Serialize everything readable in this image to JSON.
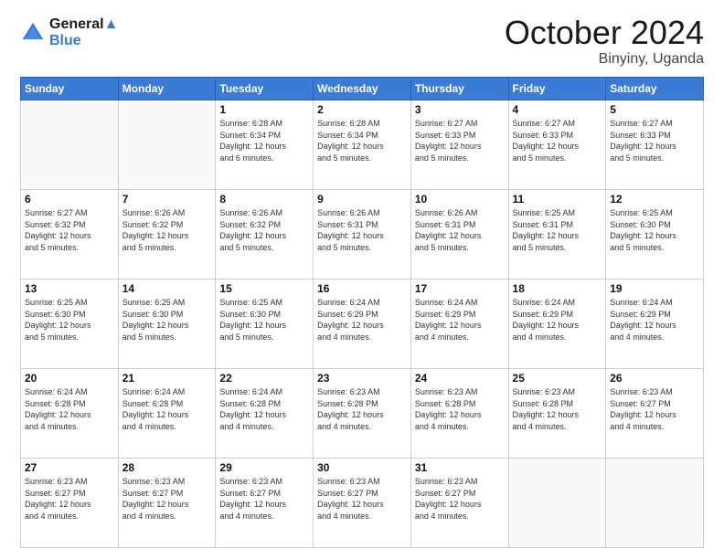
{
  "header": {
    "logo_line1": "General",
    "logo_line2": "Blue",
    "month_title": "October 2024",
    "location": "Binyiny, Uganda"
  },
  "days_of_week": [
    "Sunday",
    "Monday",
    "Tuesday",
    "Wednesday",
    "Thursday",
    "Friday",
    "Saturday"
  ],
  "weeks": [
    [
      {
        "day": "",
        "info": ""
      },
      {
        "day": "",
        "info": ""
      },
      {
        "day": "1",
        "info": "Sunrise: 6:28 AM\nSunset: 6:34 PM\nDaylight: 12 hours\nand 6 minutes."
      },
      {
        "day": "2",
        "info": "Sunrise: 6:28 AM\nSunset: 6:34 PM\nDaylight: 12 hours\nand 5 minutes."
      },
      {
        "day": "3",
        "info": "Sunrise: 6:27 AM\nSunset: 6:33 PM\nDaylight: 12 hours\nand 5 minutes."
      },
      {
        "day": "4",
        "info": "Sunrise: 6:27 AM\nSunset: 6:33 PM\nDaylight: 12 hours\nand 5 minutes."
      },
      {
        "day": "5",
        "info": "Sunrise: 6:27 AM\nSunset: 6:33 PM\nDaylight: 12 hours\nand 5 minutes."
      }
    ],
    [
      {
        "day": "6",
        "info": "Sunrise: 6:27 AM\nSunset: 6:32 PM\nDaylight: 12 hours\nand 5 minutes."
      },
      {
        "day": "7",
        "info": "Sunrise: 6:26 AM\nSunset: 6:32 PM\nDaylight: 12 hours\nand 5 minutes."
      },
      {
        "day": "8",
        "info": "Sunrise: 6:26 AM\nSunset: 6:32 PM\nDaylight: 12 hours\nand 5 minutes."
      },
      {
        "day": "9",
        "info": "Sunrise: 6:26 AM\nSunset: 6:31 PM\nDaylight: 12 hours\nand 5 minutes."
      },
      {
        "day": "10",
        "info": "Sunrise: 6:26 AM\nSunset: 6:31 PM\nDaylight: 12 hours\nand 5 minutes."
      },
      {
        "day": "11",
        "info": "Sunrise: 6:25 AM\nSunset: 6:31 PM\nDaylight: 12 hours\nand 5 minutes."
      },
      {
        "day": "12",
        "info": "Sunrise: 6:25 AM\nSunset: 6:30 PM\nDaylight: 12 hours\nand 5 minutes."
      }
    ],
    [
      {
        "day": "13",
        "info": "Sunrise: 6:25 AM\nSunset: 6:30 PM\nDaylight: 12 hours\nand 5 minutes."
      },
      {
        "day": "14",
        "info": "Sunrise: 6:25 AM\nSunset: 6:30 PM\nDaylight: 12 hours\nand 5 minutes."
      },
      {
        "day": "15",
        "info": "Sunrise: 6:25 AM\nSunset: 6:30 PM\nDaylight: 12 hours\nand 5 minutes."
      },
      {
        "day": "16",
        "info": "Sunrise: 6:24 AM\nSunset: 6:29 PM\nDaylight: 12 hours\nand 4 minutes."
      },
      {
        "day": "17",
        "info": "Sunrise: 6:24 AM\nSunset: 6:29 PM\nDaylight: 12 hours\nand 4 minutes."
      },
      {
        "day": "18",
        "info": "Sunrise: 6:24 AM\nSunset: 6:29 PM\nDaylight: 12 hours\nand 4 minutes."
      },
      {
        "day": "19",
        "info": "Sunrise: 6:24 AM\nSunset: 6:29 PM\nDaylight: 12 hours\nand 4 minutes."
      }
    ],
    [
      {
        "day": "20",
        "info": "Sunrise: 6:24 AM\nSunset: 6:28 PM\nDaylight: 12 hours\nand 4 minutes."
      },
      {
        "day": "21",
        "info": "Sunrise: 6:24 AM\nSunset: 6:28 PM\nDaylight: 12 hours\nand 4 minutes."
      },
      {
        "day": "22",
        "info": "Sunrise: 6:24 AM\nSunset: 6:28 PM\nDaylight: 12 hours\nand 4 minutes."
      },
      {
        "day": "23",
        "info": "Sunrise: 6:23 AM\nSunset: 6:28 PM\nDaylight: 12 hours\nand 4 minutes."
      },
      {
        "day": "24",
        "info": "Sunrise: 6:23 AM\nSunset: 6:28 PM\nDaylight: 12 hours\nand 4 minutes."
      },
      {
        "day": "25",
        "info": "Sunrise: 6:23 AM\nSunset: 6:28 PM\nDaylight: 12 hours\nand 4 minutes."
      },
      {
        "day": "26",
        "info": "Sunrise: 6:23 AM\nSunset: 6:27 PM\nDaylight: 12 hours\nand 4 minutes."
      }
    ],
    [
      {
        "day": "27",
        "info": "Sunrise: 6:23 AM\nSunset: 6:27 PM\nDaylight: 12 hours\nand 4 minutes."
      },
      {
        "day": "28",
        "info": "Sunrise: 6:23 AM\nSunset: 6:27 PM\nDaylight: 12 hours\nand 4 minutes."
      },
      {
        "day": "29",
        "info": "Sunrise: 6:23 AM\nSunset: 6:27 PM\nDaylight: 12 hours\nand 4 minutes."
      },
      {
        "day": "30",
        "info": "Sunrise: 6:23 AM\nSunset: 6:27 PM\nDaylight: 12 hours\nand 4 minutes."
      },
      {
        "day": "31",
        "info": "Sunrise: 6:23 AM\nSunset: 6:27 PM\nDaylight: 12 hours\nand 4 minutes."
      },
      {
        "day": "",
        "info": ""
      },
      {
        "day": "",
        "info": ""
      }
    ]
  ]
}
